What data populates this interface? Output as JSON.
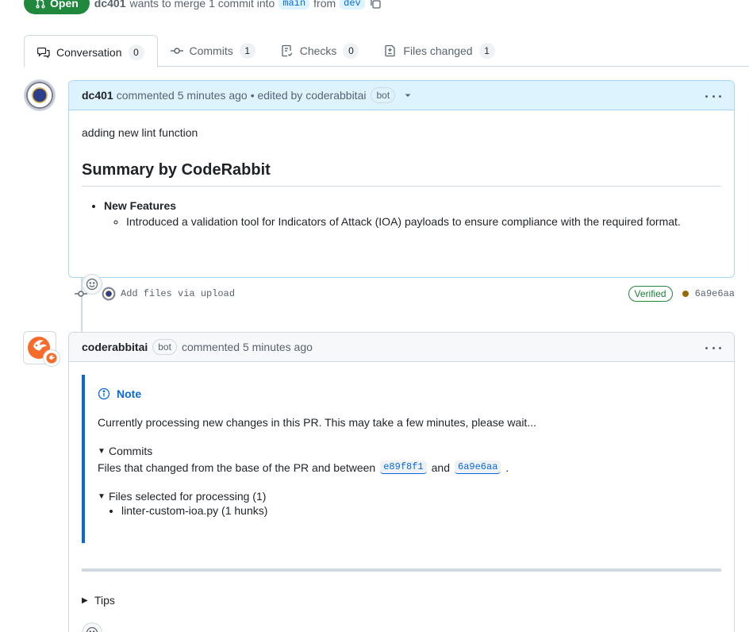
{
  "header": {
    "state": "Open",
    "author": "dc401",
    "merge_text": "wants to merge 1 commit into",
    "base_branch": "main",
    "from_text": "from",
    "head_branch": "dev"
  },
  "tabs": [
    {
      "label": "Conversation",
      "count": "0"
    },
    {
      "label": "Commits",
      "count": "1"
    },
    {
      "label": "Checks",
      "count": "0"
    },
    {
      "label": "Files changed",
      "count": "1"
    }
  ],
  "comment1": {
    "author": "dc401",
    "meta": "commented 5 minutes ago",
    "edited": "• edited by coderabbitai",
    "bot": "bot",
    "intro": "adding new lint function",
    "heading": "Summary by CodeRabbit",
    "feature_title": "New Features",
    "feature_item": "Introduced a validation tool for Indicators of Attack (IOA) payloads to ensure compliance with the required format."
  },
  "commit": {
    "message": "Add files via upload",
    "verified": "Verified",
    "sha": "6a9e6aa"
  },
  "comment2": {
    "author": "coderabbitai",
    "bot": "bot",
    "meta": "commented 5 minutes ago",
    "note_title": "Note",
    "note_text": "Currently processing new changes in this PR. This may take a few minutes, please wait...",
    "commits_summary": "Commits",
    "files_changed_prefix": "Files that changed from the base of the PR and between",
    "sha_from": "e89f8f1",
    "and_text": "and",
    "sha_to": "6a9e6aa",
    "period": ".",
    "files_selected_summary": "Files selected for processing (1)",
    "file_item": "linter-custom-ioa.py (1 hunks)",
    "tips": "Tips"
  },
  "colors": {
    "open_green": "#1f883d",
    "link_blue": "#0969da",
    "border": "#d1d9e0"
  }
}
